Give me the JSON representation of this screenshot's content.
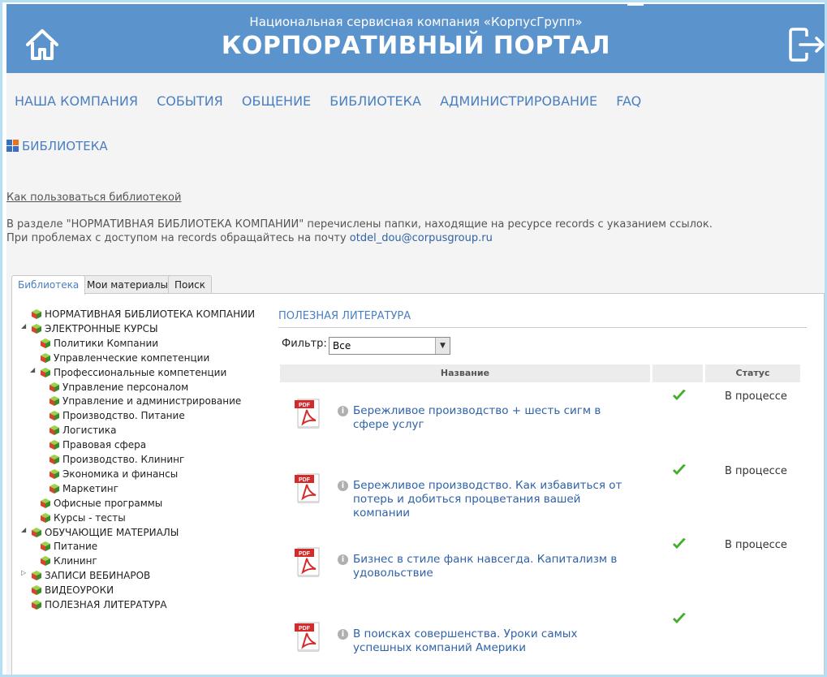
{
  "header": {
    "subtitle": "Национальная сервисная компания «КорпусГрупп»",
    "title": "КОРПОРАТИВНЫЙ ПОРТАЛ",
    "bar_color": "#5b93cd",
    "home_icon": "home-icon",
    "exit_icon": "logout-icon"
  },
  "nav": [
    "НАША КОМПАНИЯ",
    "СОБЫТИЯ",
    "ОБЩЕНИЕ",
    "БИБЛИОТЕКА",
    "АДМИНИСТРИРОВАНИЕ",
    "FAQ"
  ],
  "section": {
    "title": "БИБЛИОТЕКА",
    "icon": "grid-icon"
  },
  "help_link": "Как пользоваться библиотекой",
  "info": {
    "line1": "В разделе \"НОРМАТИВНАЯ БИБЛИОТЕКА КОМПАНИИ\" перечислены папки, находящие на ресурсе records с указанием ссылок.",
    "line2_prefix": "При проблемах с доступом на records обращайтесь на почту",
    "email": "otdel_dou@corpusgroup.ru"
  },
  "tabs": [
    "Библиотека",
    "Мои материалы",
    "Поиск"
  ],
  "tree": [
    "НОРМАТИВНАЯ БИБЛИОТЕКА КОМПАНИИ",
    "ЭЛЕКТРОННЫЕ КУРСЫ",
    "Политики Компании",
    "Управленческие компетенции",
    "Профессиональные компетенции",
    "Управление персоналом",
    "Управление и администрирование",
    "Производство. Питание",
    "Логистика",
    "Правовая сфера",
    "Производство. Клининг",
    "Экономика и финансы",
    "Маркетинг",
    "Офисные программы",
    "Курсы - тесты",
    "ОБУЧАЮЩИЕ МАТЕРИАЛЫ",
    "Питание",
    "Клининг",
    "ЗАПИСИ ВЕБИНАРОВ",
    "ВИДЕОУРОКИ",
    "ПОЛЕЗНАЯ ЛИТЕРАТУРА"
  ],
  "content": {
    "title": "ПОЛЕЗНАЯ ЛИТЕРАТУРА",
    "filter_label": "Фильтр:",
    "filter_value": "Все",
    "columns": {
      "name": "Название",
      "status": "Статус"
    },
    "rows": [
      {
        "title": "Бережливое производство + шесть сигм в сфере услуг",
        "status": "В процессе"
      },
      {
        "title": "Бережливое производство. Как избавиться от потерь и добиться процветания вашей компании",
        "status": "В процессе"
      },
      {
        "title": "Бизнес в стиле фанк навсегда. Капитализм в удовольствие",
        "status": "В процессе"
      },
      {
        "title": "В поисках совершенства. Уроки самых успешных компаний Америки",
        "status": ""
      }
    ]
  }
}
